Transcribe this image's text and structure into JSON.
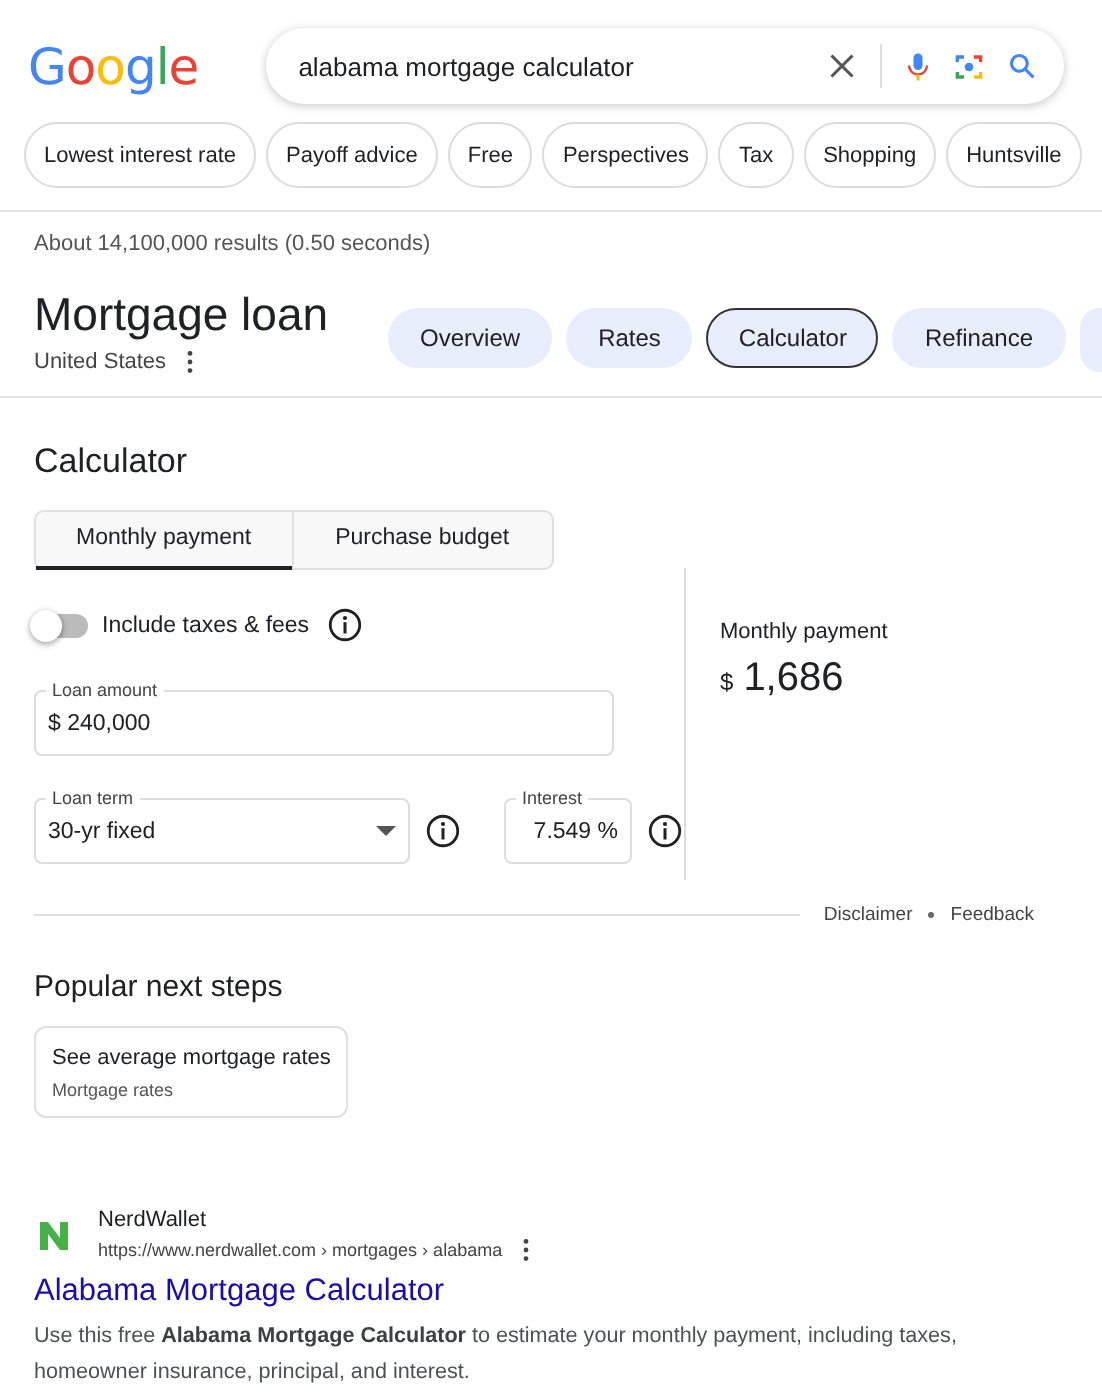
{
  "logo": "Google",
  "search": {
    "value": "alabama mortgage calculator"
  },
  "chips": [
    {
      "label": "Lowest interest rate"
    },
    {
      "label": "Payoff advice"
    },
    {
      "label": "Free"
    },
    {
      "label": "Perspectives"
    },
    {
      "label": "Tax"
    },
    {
      "label": "Shopping"
    },
    {
      "label": "Huntsville"
    }
  ],
  "result_stats": "About 14,100,000 results (0.50 seconds)",
  "topic": {
    "title": "Mortgage loan",
    "subtitle": "United States",
    "tabs": [
      {
        "label": "Overview",
        "selected": false
      },
      {
        "label": "Rates",
        "selected": false
      },
      {
        "label": "Calculator",
        "selected": true
      },
      {
        "label": "Refinance",
        "selected": false
      }
    ]
  },
  "calculator": {
    "title": "Calculator",
    "modes": [
      {
        "label": "Monthly payment",
        "selected": true
      },
      {
        "label": "Purchase budget",
        "selected": false
      }
    ],
    "toggle": {
      "label": "Include taxes & fees",
      "on": false
    },
    "loan_amount": {
      "label": "Loan amount",
      "value": "$ 240,000"
    },
    "loan_term": {
      "label": "Loan term",
      "value": "30-yr fixed"
    },
    "interest": {
      "label": "Interest",
      "value": "7.549 %"
    },
    "result": {
      "label": "Monthly payment",
      "currency": "$",
      "amount": "1,686"
    },
    "footer_links": [
      "Disclaimer",
      "Feedback"
    ]
  },
  "popular": {
    "title": "Popular next steps",
    "cards": [
      {
        "title": "See average mortgage rates",
        "subtitle": "Mortgage rates"
      }
    ]
  },
  "result": {
    "site": "NerdWallet",
    "url": "https://www.nerdwallet.com › mortgages › alabama",
    "title": "Alabama Mortgage Calculator",
    "snippet": "Use this free **Alabama Mortgage Calculator** to estimate your monthly payment, including taxes, homeowner insurance, principal, and interest."
  }
}
